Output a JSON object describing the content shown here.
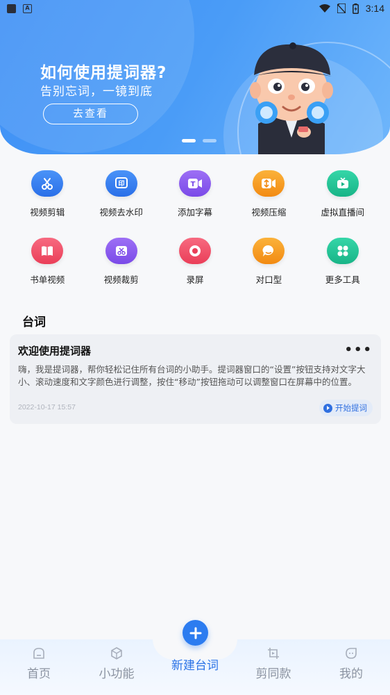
{
  "status_bar": {
    "time": "3:14",
    "app_badge": "A"
  },
  "banner": {
    "title": "如何使用提词器?",
    "subtitle": "告别忘词，一镜到底",
    "button_label": "去查看",
    "page_count": 2,
    "active_page": 1
  },
  "tools": [
    {
      "label": "视频剪辑",
      "icon": "scissors-icon",
      "color": "#2f7cf2"
    },
    {
      "label": "视频去水印",
      "icon": "watermark-icon",
      "color": "#2f7cf2"
    },
    {
      "label": "添加字幕",
      "icon": "subtitle-icon",
      "color": "#8a5cf0"
    },
    {
      "label": "视频压缩",
      "icon": "compress-icon",
      "color": "#f59a1e"
    },
    {
      "label": "虚拟直播间",
      "icon": "live-tv-icon",
      "color": "#22c59a"
    },
    {
      "label": "书单视频",
      "icon": "book-icon",
      "color": "#f0506a"
    },
    {
      "label": "视频裁剪",
      "icon": "crop-icon",
      "color": "#8a5cf0"
    },
    {
      "label": "录屏",
      "icon": "record-icon",
      "color": "#f0506a"
    },
    {
      "label": "对口型",
      "icon": "chat-bubble-icon",
      "color": "#f59a1e"
    },
    {
      "label": "更多工具",
      "icon": "grid-more-icon",
      "color": "#22c59a"
    }
  ],
  "section": {
    "title": "台词"
  },
  "script_card": {
    "title": "欢迎使用提词器",
    "more": "•••",
    "body": "嗨，我是提词器，帮你轻松记住所有台词的小助手。提词器窗口的“设置”按钮支持对文字大小、滚动速度和文字颜色进行调整，按住“移动”按钮拖动可以调整窗口在屏幕中的位置。",
    "date": "2022-10-17 15:57",
    "action_label": "开始提词"
  },
  "tabbar": {
    "tabs": [
      {
        "label": "首页",
        "icon": "home-icon"
      },
      {
        "label": "小功能",
        "icon": "box-icon"
      },
      {
        "label": "剪同款",
        "icon": "template-icon"
      },
      {
        "label": "我的",
        "icon": "profile-icon"
      }
    ],
    "center_label": "新建台词",
    "center_icon": "plus-icon"
  },
  "colors": {
    "primary": "#2c7cf0",
    "banner": "#4a9cf7"
  }
}
